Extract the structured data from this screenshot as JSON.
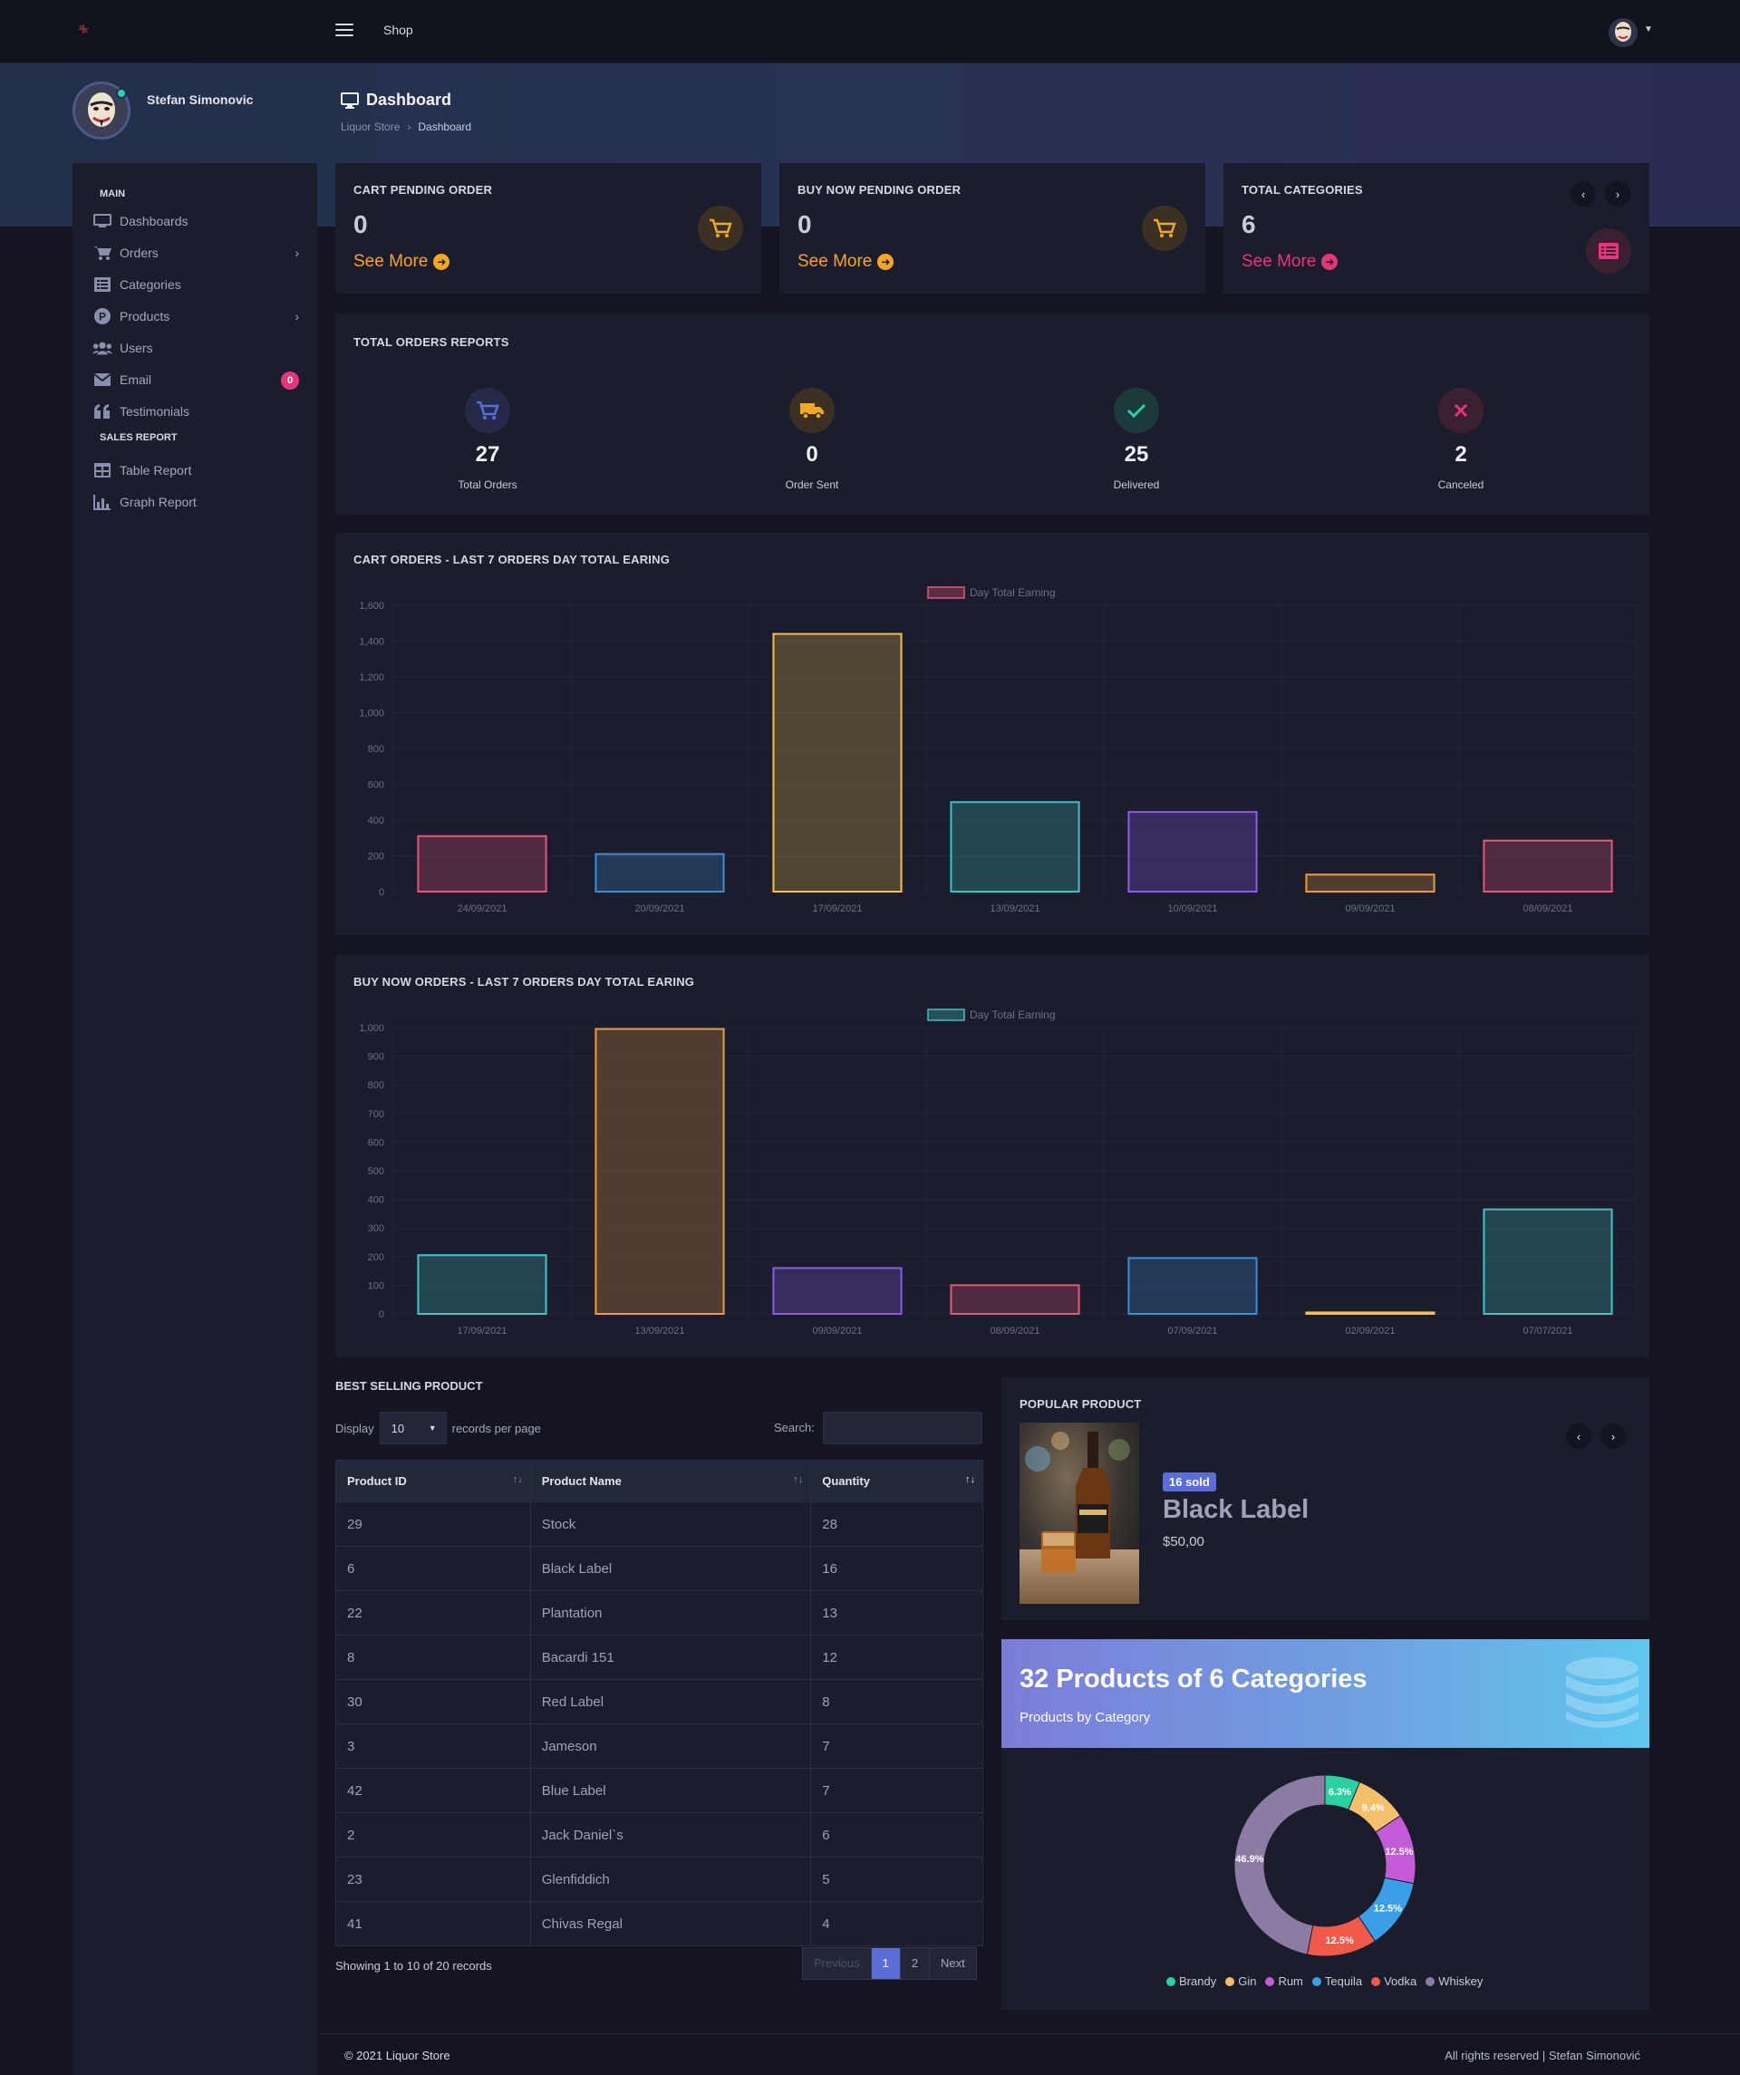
{
  "topbar": {
    "shop_label": "Shop"
  },
  "profile": {
    "name": "Stefan Simonovic"
  },
  "header": {
    "title": "Dashboard",
    "breadcrumb": [
      "Liquor Store",
      "Dashboard"
    ]
  },
  "sidebar": {
    "section_main": "MAIN",
    "items": [
      {
        "label": "Dashboards",
        "icon": "monitor-icon"
      },
      {
        "label": "Orders",
        "icon": "cart-icon"
      },
      {
        "label": "Categories",
        "icon": "list-icon"
      },
      {
        "label": "Products",
        "icon": "p-circle-icon"
      },
      {
        "label": "Users",
        "icon": "users-icon"
      },
      {
        "label": "Email",
        "icon": "envelope-icon",
        "badge": "0"
      },
      {
        "label": "Testimonials",
        "icon": "quote-icon"
      }
    ],
    "section_sales": "SALES REPORT",
    "sales_items": [
      {
        "label": "Table Report",
        "icon": "table-icon"
      },
      {
        "label": "Graph Report",
        "icon": "bar-chart-icon"
      }
    ]
  },
  "stats": [
    {
      "title": "CART PENDING ORDER",
      "value": "0",
      "link": "See More",
      "color": "#f5a623"
    },
    {
      "title": "BUY NOW PENDING ORDER",
      "value": "0",
      "link": "See More",
      "color": "#f5a623"
    },
    {
      "title": "TOTAL CATEGORIES",
      "value": "6",
      "link": "See More",
      "color": "#e8357a"
    }
  ],
  "orders_report": {
    "title": "TOTAL ORDERS REPORTS",
    "items": [
      {
        "value": "27",
        "label": "Total Orders",
        "color": "#5b6dd8"
      },
      {
        "value": "0",
        "label": "Order Sent",
        "color": "#f5a623"
      },
      {
        "value": "25",
        "label": "Delivered",
        "color": "#2ad1b0"
      },
      {
        "value": "2",
        "label": "Canceled",
        "color": "#e8357a"
      }
    ]
  },
  "chart_data": [
    {
      "type": "bar",
      "title": "CART ORDERS - LAST 7 ORDERS DAY TOTAL EARING",
      "legend": "Day Total Earning",
      "categories": [
        "24/09/2021",
        "20/09/2021",
        "17/09/2021",
        "13/09/2021",
        "10/09/2021",
        "09/09/2021",
        "08/09/2021"
      ],
      "values": [
        310,
        210,
        1440,
        500,
        445,
        95,
        285
      ],
      "ylim": [
        0,
        1600
      ],
      "yticks": [
        "0",
        "200",
        "400",
        "600",
        "800",
        "1,000",
        "1,200",
        "1,400",
        "1,600"
      ],
      "colors": [
        "#e8577a",
        "#3a8fdc",
        "#f5c14a",
        "#3ec4c4",
        "#8a5cf0",
        "#f59a3c",
        "#e8577a"
      ],
      "legend_color": "#e8577a"
    },
    {
      "type": "bar",
      "title": "BUY NOW ORDERS - LAST 7 ORDERS DAY TOTAL EARING",
      "legend": "Day Total Earning",
      "categories": [
        "17/09/2021",
        "13/09/2021",
        "09/09/2021",
        "08/09/2021",
        "07/09/2021",
        "02/09/2021",
        "07/07/2021"
      ],
      "values": [
        205,
        995,
        160,
        100,
        195,
        5,
        365
      ],
      "ylim": [
        0,
        1000
      ],
      "yticks": [
        "0",
        "100",
        "200",
        "300",
        "400",
        "500",
        "600",
        "700",
        "800",
        "900",
        "1,000"
      ],
      "colors": [
        "#3ec4c4",
        "#f59a3c",
        "#8a5cf0",
        "#e8577a",
        "#3a8fdc",
        "#f5c14a",
        "#3ec4c4"
      ],
      "legend_color": "#3ec4c4"
    },
    {
      "type": "pie",
      "title": "Products by Category",
      "labels": [
        "Brandy",
        "Gin",
        "Rum",
        "Tequila",
        "Vodka",
        "Whiskey"
      ],
      "values": [
        6.3,
        9.4,
        12.5,
        12.5,
        12.5,
        46.9
      ],
      "display": [
        "6.3%",
        "9.4%",
        "12.5%",
        "12.5%",
        "12.5%",
        "46.9%"
      ],
      "colors": [
        "#2ad1a0",
        "#f5c06a",
        "#c45cd8",
        "#3a9fe8",
        "#f05a4a",
        "#8c7ba2"
      ]
    }
  ],
  "best_selling": {
    "title": "BEST SELLING PRODUCT",
    "display_label": "Display",
    "per_page": "10",
    "records_label": "records per page",
    "search_label": "Search:",
    "columns": [
      "Product ID",
      "Product Name",
      "Quantity"
    ],
    "rows": [
      [
        "29",
        "Stock",
        "28"
      ],
      [
        "6",
        "Black Label",
        "16"
      ],
      [
        "22",
        "Plantation",
        "13"
      ],
      [
        "8",
        "Bacardi 151",
        "12"
      ],
      [
        "30",
        "Red Label",
        "8"
      ],
      [
        "3",
        "Jameson",
        "7"
      ],
      [
        "42",
        "Blue Label",
        "7"
      ],
      [
        "2",
        "Jack Daniel`s",
        "6"
      ],
      [
        "23",
        "Glenfiddich",
        "5"
      ],
      [
        "41",
        "Chivas Regal",
        "4"
      ]
    ],
    "showing": "Showing 1 to 10 of 20 records",
    "pager": {
      "prev": "Previous",
      "pages": [
        "1",
        "2"
      ],
      "next": "Next"
    }
  },
  "popular": {
    "title": "POPULAR PRODUCT",
    "badge": "16 sold",
    "name": "Black Label",
    "price": "$50,00"
  },
  "categories_banner": {
    "title": "32 Products of 6 Categories",
    "subtitle": "Products by Category"
  },
  "footer": {
    "left": "© 2021 Liquor Store",
    "right": "All rights reserved | Stefan Simonović"
  }
}
